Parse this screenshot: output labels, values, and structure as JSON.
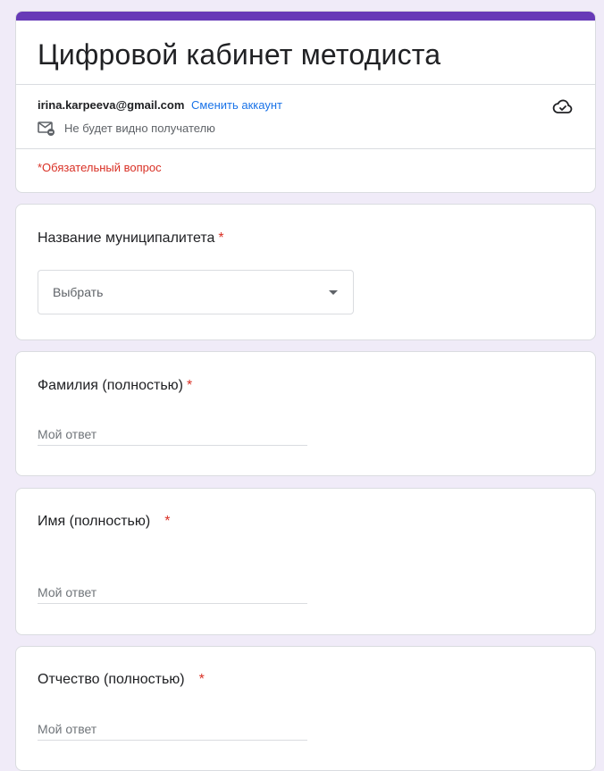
{
  "form": {
    "title": "Цифровой кабинет методиста",
    "accent_color": "#673ab7",
    "account_email": "irina.karpeeva@gmail.com",
    "switch_account_label": "Сменить аккаунт",
    "hidden_notice": "Не будет видно получателю",
    "required_note": "*Обязательный вопрос",
    "cloud_icon": "cloud-saved-icon",
    "mail_icon": "mail-hidden-icon"
  },
  "questions": [
    {
      "title": "Название муниципалитета",
      "required_mark": "*",
      "type": "dropdown",
      "selected": "Выбрать"
    },
    {
      "title": "Фамилия (полностью)",
      "required_mark": "*",
      "type": "short_answer",
      "placeholder": "Мой ответ"
    },
    {
      "title": "Имя (полностью)",
      "required_mark": "*",
      "type": "short_answer",
      "placeholder": "Мой ответ"
    },
    {
      "title": "Отчество (полностью)",
      "required_mark": "*",
      "type": "short_answer",
      "placeholder": "Мой ответ"
    }
  ]
}
